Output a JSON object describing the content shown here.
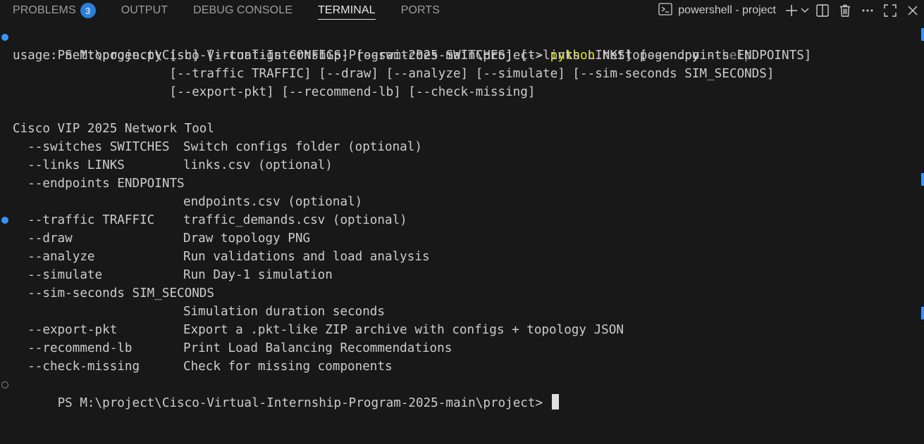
{
  "tabs": [
    {
      "label": "PROBLEMS",
      "badge": "3",
      "active": false
    },
    {
      "label": "OUTPUT",
      "active": false
    },
    {
      "label": "DEBUG CONSOLE",
      "active": false
    },
    {
      "label": "TERMINAL",
      "active": true
    },
    {
      "label": "PORTS",
      "active": false
    }
  ],
  "terminal_selector": {
    "label": "powershell - project",
    "icon": "terminal-powershell-icon"
  },
  "actions": [
    {
      "name": "new-terminal-icon"
    },
    {
      "name": "launch-profile-chevron-icon"
    },
    {
      "name": "split-terminal-icon"
    },
    {
      "name": "kill-terminal-icon"
    },
    {
      "name": "more-actions-icon"
    },
    {
      "name": "maximize-panel-icon"
    },
    {
      "name": "close-panel-icon"
    }
  ],
  "terminal": {
    "prompt1": {
      "prompt": "PS M:\\project\\Cisco-Virtual-Internship-Program-2025-main\\project> ",
      "command": "python",
      "script": " nettopogen.py",
      "flag": " --help"
    },
    "usage": [
      "usage: nettopogen.py [-h] [--configs CONFIGS] [--switches SWITCHES] [--links LINKS] [--endpoints ENDPOINTS]",
      "                     [--traffic TRAFFIC] [--draw] [--analyze] [--simulate] [--sim-seconds SIM_SECONDS]",
      "                     [--export-pkt] [--recommend-lb] [--check-missing]"
    ],
    "description": "Cisco VIP 2025 Network Tool",
    "options": [
      {
        "flag": "  --switches SWITCHES",
        "help": "Switch configs folder (optional)"
      },
      {
        "flag": "  --links LINKS",
        "help": "links.csv (optional)"
      },
      {
        "flag": "  --endpoints ENDPOINTS",
        "help": ""
      },
      {
        "flag": "",
        "help": "endpoints.csv (optional)"
      },
      {
        "flag": "  --traffic TRAFFIC",
        "help": "traffic_demands.csv (optional)"
      },
      {
        "flag": "  --draw",
        "help": "Draw topology PNG"
      },
      {
        "flag": "  --analyze",
        "help": "Run validations and load analysis"
      },
      {
        "flag": "  --simulate",
        "help": "Run Day-1 simulation"
      },
      {
        "flag": "  --sim-seconds SIM_SECONDS",
        "help": ""
      },
      {
        "flag": "",
        "help": "Simulation duration seconds"
      },
      {
        "flag": "  --export-pkt",
        "help": "Export a .pkt-like ZIP archive with configs + topology JSON"
      },
      {
        "flag": "  --recommend-lb",
        "help": "Print Load Balancing Recommendations"
      },
      {
        "flag": "  --check-missing",
        "help": "Check for missing components"
      }
    ],
    "prompt2": "PS M:\\project\\Cisco-Virtual-Internship-Program-2025-main\\project> "
  },
  "colors": {
    "background": "#181818",
    "command": "#e5e510",
    "flag_dim": "#8c8c8c",
    "accent": "#3794ff"
  }
}
